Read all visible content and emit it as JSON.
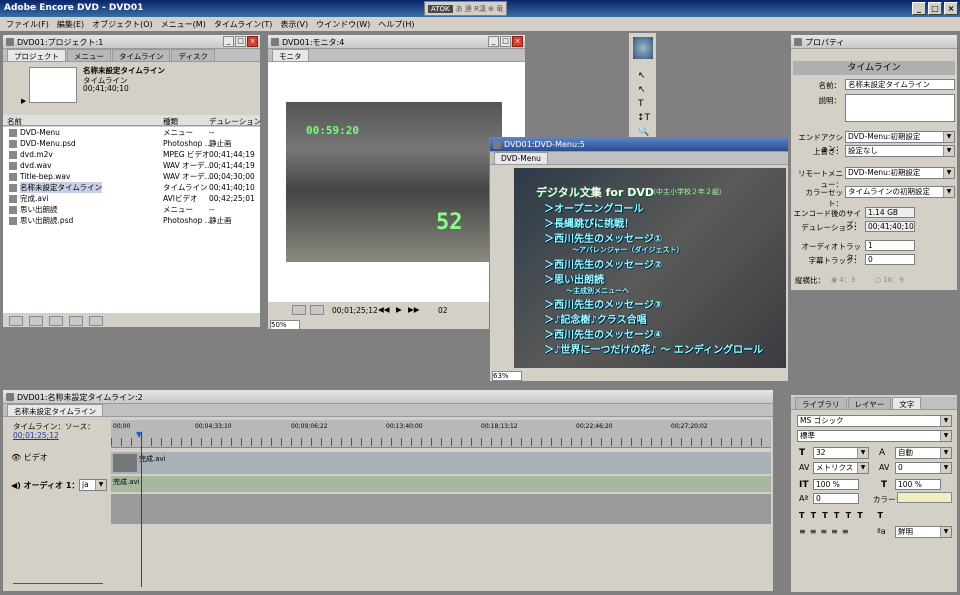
{
  "app": {
    "title": "Adobe Encore DVD - DVD01"
  },
  "menu": [
    "ファイル(F)",
    "編集(E)",
    "オブジェクト(O)",
    "メニュー(M)",
    "タイムライン(T)",
    "表示(V)",
    "ウインドウ(W)",
    "ヘルプ(H)"
  ],
  "ime": {
    "label": "ATOK",
    "modes": "あ 連 R漢 ⊕ 竜"
  },
  "project": {
    "title": "DVD01:プロジェクト:1",
    "tabs": [
      "プロジェクト",
      "メニュー",
      "タイムライン",
      "ディスク"
    ],
    "preview_name": "名称未設定タイムライン",
    "preview_type": "タイムライン",
    "preview_duration": "00;41;40;10",
    "headers": [
      "名前",
      "種類",
      "デュレーション"
    ],
    "rows": [
      {
        "name": "DVD-Menu",
        "type": "メニュー",
        "dur": "--"
      },
      {
        "name": "DVD-Menu.psd",
        "type": "Photoshop ...",
        "dur": "静止画"
      },
      {
        "name": "dvd.m2v",
        "type": "MPEG ビデオ",
        "dur": "00;41;44;19"
      },
      {
        "name": "dvd.wav",
        "type": "WAV オーデ...",
        "dur": "00;41;44;19"
      },
      {
        "name": "Title-bep.wav",
        "type": "WAV オーデ...",
        "dur": "00;04;30;00"
      },
      {
        "name": "名称未設定タイムライン",
        "type": "タイムライン",
        "dur": "00;41;40;10"
      },
      {
        "name": "完成.avi",
        "type": "AVIビデオ",
        "dur": "00;42;25;01"
      },
      {
        "name": "思い出朗読",
        "type": "メニュー",
        "dur": "--"
      },
      {
        "name": "思い出朗読.psd",
        "type": "Photoshop ...",
        "dur": "静止画"
      }
    ]
  },
  "monitor": {
    "title": "DVD01:モニタ:4",
    "tab": "モニタ",
    "overlay_time": "00:59:20",
    "overlay_number": "52",
    "timecode": "00;01;25;12",
    "track": "02",
    "zoom": "50%"
  },
  "dvdmenu": {
    "title": "DVD01:DVD-Menu:5",
    "tab": "DVD-Menu",
    "heading": "デジタル文集 for DVD",
    "heading_sub": "（中主小学校２年２組）",
    "items": [
      "＞オープニングコール",
      "＞長縄跳びに挑戦！",
      "＞西川先生のメッセージ①",
      "～アバレンジャー（ダイジェスト）",
      "＞西川先生のメッセージ②",
      "＞思い出朗読",
      "～主成別メニューへ",
      "＞西川先生のメッセージ③",
      "＞♪記念樹♪クラス合唱",
      "＞西川先生のメッセージ④",
      "＞♪世界に一つだけの花♪ ～ エンディングロール"
    ],
    "zoom": "63%"
  },
  "properties": {
    "title": "プロパティ",
    "heading": "タイムライン",
    "name_label": "名前：",
    "name_value": "名称未設定タイムライン",
    "desc_label": "説明：",
    "end_action_label": "エンドアクション：",
    "end_action_value": "DVD-Menu:初期設定",
    "override_label": "上書き：",
    "override_value": "設定なし",
    "remote_label": "リモートメニュー：",
    "remote_value": "DVD-Menu:初期設定",
    "color_label": "カラーセット：",
    "color_value": "タイムラインの初期設定",
    "encode_label": "エンコード後のサイズ：",
    "encode_value": "1.14 GB",
    "duration_label": "デュレーション：",
    "duration_value": "00;41;40;10",
    "audio_label": "オーディオトラック：",
    "audio_value": "1",
    "subtitle_label": "字幕トラック：",
    "subtitle_value": "0",
    "aspect_label": "縦横比：",
    "aspect_a": "4：3",
    "aspect_b": "16：9"
  },
  "character": {
    "tabs": [
      "ライブラリ",
      "レイヤー",
      "文字"
    ],
    "font": "MS ゴシック",
    "style": "標準",
    "size": "32",
    "leading": "自動",
    "kerning": "メトリクス",
    "tracking": "0",
    "vscale": "100 %",
    "hscale": "100 %",
    "baseline": "0",
    "color_label": "カラー：",
    "antialias": "鮮明"
  },
  "timeline": {
    "title": "DVD01:名称未設定タイムライン:2",
    "tab": "名称未設定タイムライン",
    "source_label": "タイムライン：ソース：",
    "timecode": "00;01;25;12",
    "ruler": [
      "00;00",
      "00;04;33;10",
      "00;09;06;22",
      "00;13;40;00",
      "00;18;13;12",
      "00;22;46;20",
      "00;27;20;02"
    ],
    "video_label": "ビデオ",
    "audio_label": "オーディオ 1：",
    "audio_lang": "ja",
    "clip_name": "完成.avi"
  },
  "colors": {
    "accent": "#2a4f90",
    "menu_text": "#99ffff",
    "char_color": "#f0eec0"
  }
}
